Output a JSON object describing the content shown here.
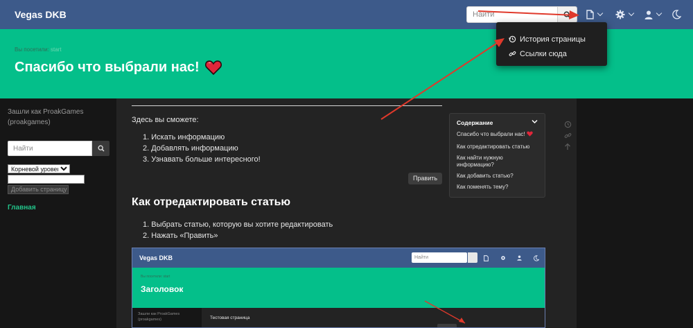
{
  "navbar": {
    "brand": "Vegas DKB",
    "search_placeholder": "Найти",
    "icons": [
      "search-icon",
      "page-icon",
      "gear-icon",
      "user-icon",
      "moon-icon"
    ]
  },
  "page_menu": {
    "items": [
      {
        "label": "История страницы",
        "icon": "history-icon"
      },
      {
        "label": "Ссылки сюда",
        "icon": "link-icon"
      }
    ]
  },
  "hero": {
    "breadcrumb_prefix": "Вы посетили: ",
    "breadcrumb_link": "start",
    "title": "Спасибо что выбрали нас!",
    "title_emoji": "heart"
  },
  "sidebar": {
    "login_text": "Зашли как ProakGames (proakgames)",
    "search_placeholder": "Найти",
    "level_select_value": "Корневой уровень",
    "add_page_label": "Добавить страницу",
    "nav_link": "Главная"
  },
  "content": {
    "intro": "Здесь вы сможете:",
    "list1": [
      "1. Искать информацию",
      "2. Добавлять информацию",
      "3. Узнавать больше интересного!"
    ],
    "edit_button": "Править",
    "heading2": "Как отредактировать статью",
    "list2": [
      "1. Выбрать статью, которую вы хотите редактировать",
      "2. Нажать «Править»"
    ]
  },
  "toc": {
    "title": "Содержание",
    "items": [
      "Спасибо что выбрали нас!",
      "Как отредактировать статью",
      "Как найти нужную информацию?",
      "Как добавить статью?",
      "Как поменять тему?"
    ]
  },
  "screenshot": {
    "brand": "Vegas DKB",
    "search_placeholder": "Найти",
    "breadcrumb": "Вы посетили: start",
    "title": "Заголовок",
    "login_text": "Зашли как ProakGames (proakgames)",
    "page_title": "Тестовая страница"
  },
  "colors": {
    "navbar": "#3d5a8a",
    "hero": "#04bf8a",
    "annotation_arrow": "#e0392b",
    "link_green": "#22c48a"
  }
}
